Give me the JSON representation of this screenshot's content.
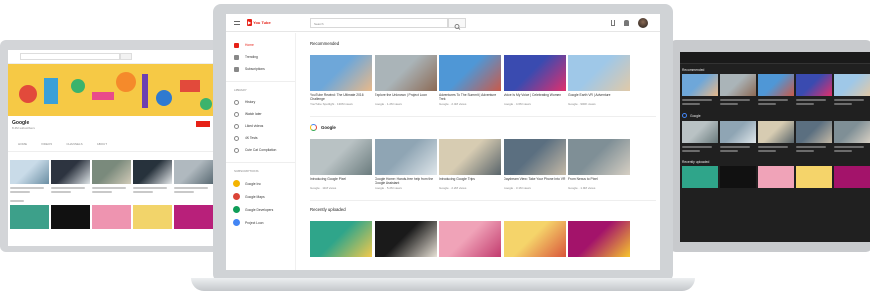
{
  "app": {
    "logo_text": "You Tube",
    "search_placeholder": "Search"
  },
  "center": {
    "sidebar_primary": [
      {
        "label": "Home",
        "icon": "home-icon",
        "active": true
      },
      {
        "label": "Trending",
        "icon": "fire-icon",
        "active": false
      },
      {
        "label": "Subscriptions",
        "icon": "subscriptions-icon",
        "active": false
      }
    ],
    "library_header": "LIBRARY",
    "sidebar_library": [
      {
        "label": "History",
        "icon": "history-icon"
      },
      {
        "label": "Watch later",
        "icon": "clock-icon"
      },
      {
        "label": "Liked videos",
        "icon": "like-icon"
      },
      {
        "label": "4K Tests",
        "icon": "playlist-icon"
      },
      {
        "label": "Cute Cat Compilation",
        "icon": "playlist-icon"
      }
    ],
    "subscriptions_header": "SUBSCRIPTIONS",
    "sidebar_subscriptions": [
      {
        "label": "Google Inc",
        "color": "#f4b400"
      },
      {
        "label": "Google Maps",
        "color": "#db4437"
      },
      {
        "label": "Google Developers",
        "color": "#0f9d58"
      },
      {
        "label": "Project Loon",
        "color": "#4285f4"
      }
    ],
    "section_recommended": "Recommended",
    "recommended": [
      {
        "title": "YouTube Rewind: The Ultimate 2016 Challenge",
        "meta": "YouTube Spotlight · 130M views",
        "colors": [
          "#6ea7d9",
          "#e8b98a"
        ]
      },
      {
        "title": "Explore the Unknown | Project Loon",
        "meta": "Google · 1.2M views",
        "colors": [
          "#aab4b8",
          "#8c6a55"
        ]
      },
      {
        "title": "Adventures To The Summit | Adventure Trek",
        "meta": "Google · 2.4M views",
        "colors": [
          "#4f97d6",
          "#c95a4a"
        ]
      },
      {
        "title": "Voice Is My Voice | Celebrating Women",
        "meta": "Google · 4.6M views",
        "colors": [
          "#3a4bb0",
          "#e12f6c"
        ]
      },
      {
        "title": "Google Earth VR | Adventure",
        "meta": "Google · 900K views",
        "colors": [
          "#9fc8e8",
          "#e0c9a8"
        ]
      }
    ],
    "section_google": "Google",
    "google_videos": [
      {
        "title": "Introducing Google Pixel",
        "meta": "Google · 11M views",
        "colors": [
          "#b9c2c4",
          "#6a7b7d"
        ]
      },
      {
        "title": "Google Home: Hands-free help from the Google Assistant",
        "meta": "Google · 5.2M views",
        "colors": [
          "#8fa5b4",
          "#dfe6ea"
        ]
      },
      {
        "title": "Introducing Google Trips",
        "meta": "Google · 2.2M views",
        "colors": [
          "#d7ccb2",
          "#59646a"
        ]
      },
      {
        "title": "Daydream View: Take Your Phone Into VR",
        "meta": "Google · 3.1M views",
        "colors": [
          "#5b6f80",
          "#c4b9a6"
        ]
      },
      {
        "title": "From Nexus to Pixel",
        "meta": "Google · 1.9M views",
        "colors": [
          "#7f8f96",
          "#d6cfc3"
        ]
      }
    ],
    "section_uploaded": "Recently uploaded",
    "uploaded": [
      {
        "colors": [
          "#2fa58a",
          "#f2c94c"
        ]
      },
      {
        "colors": [
          "#1a1a1a",
          "#e8e1d6"
        ]
      },
      {
        "colors": [
          "#f0a3b8",
          "#c23b6e"
        ]
      },
      {
        "colors": [
          "#f5d46a",
          "#d9553a"
        ]
      },
      {
        "colors": [
          "#a3136a",
          "#f7c52d"
        ]
      }
    ]
  },
  "left": {
    "channel_name": "Google",
    "channel_meta": "8.4M subscribers",
    "tabs": [
      "HOME",
      "VIDEOS",
      "CHANNELS",
      "ABOUT"
    ],
    "subscribe_label": "",
    "row_colors": [
      [
        "#c9dbe8",
        "#6a8ea3"
      ],
      [
        "#2d3440",
        "#dde3e6"
      ],
      [
        "#7a8a7c",
        "#d1cbb8"
      ],
      [
        "#27323c",
        "#e5e8ea"
      ],
      [
        "#b0b9bf",
        "#596a73"
      ]
    ],
    "bottom_colors": [
      "#3da08a",
      "#111111",
      "#ee94b0",
      "#f2d46a",
      "#b8207a"
    ]
  },
  "right": {
    "section_recommended": "Recommended",
    "section_google": "Google",
    "section_uploaded": "Recently uploaded",
    "rec_colors": [
      [
        "#6ea7d9",
        "#e8b98a"
      ],
      [
        "#aab4b8",
        "#8c6a55"
      ],
      [
        "#4f97d6",
        "#c95a4a"
      ],
      [
        "#3a4bb0",
        "#e12f6c"
      ],
      [
        "#9fc8e8",
        "#e0c9a8"
      ]
    ],
    "google_colors": [
      [
        "#b9c2c4",
        "#6a7b7d"
      ],
      [
        "#8fa5b4",
        "#dfe6ea"
      ],
      [
        "#d7ccb2",
        "#59646a"
      ],
      [
        "#5b6f80",
        "#c4b9a6"
      ],
      [
        "#7f8f96",
        "#d6cfc3"
      ]
    ],
    "upload_colors": [
      "#2fa58a",
      "#111111",
      "#f0a3b8",
      "#f5d46a",
      "#a3136a"
    ]
  }
}
